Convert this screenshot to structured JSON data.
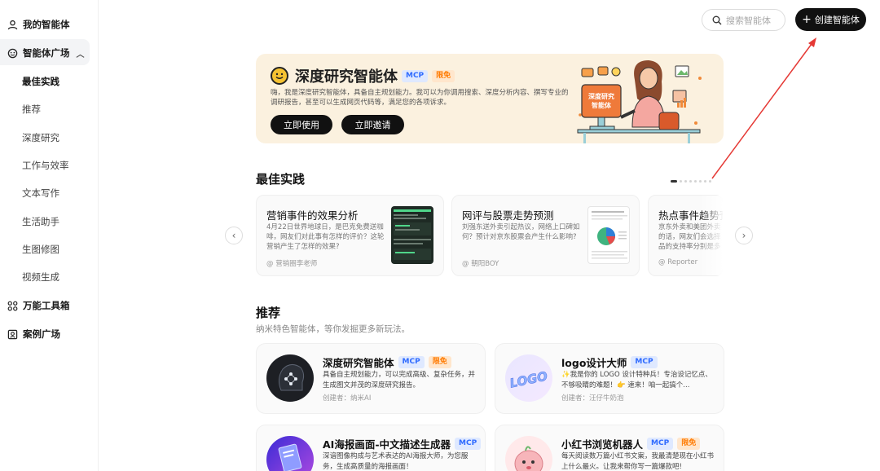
{
  "sidebar": {
    "my_agents": "我的智能体",
    "plaza": "智能体广场",
    "sub_items": [
      "最佳实践",
      "推荐",
      "深度研究",
      "工作与效率",
      "文本写作",
      "生活助手",
      "生图修图",
      "视频生成"
    ],
    "toolbox": "万能工具箱",
    "case_plaza": "案例广场"
  },
  "header": {
    "search_placeholder": "搜索智能体",
    "create_button": "创建智能体"
  },
  "banner": {
    "title": "深度研究智能体",
    "tag_mcp": "MCP",
    "tag_free": "限免",
    "description": "嗨，我是深度研究智能体，具备自主规划能力。我可以为你调用搜索、深度分析内容、撰写专业的调研报告，甚至可以生成网页代码等，满足您的各项诉求。",
    "use_button": "立即使用",
    "invite_button": "立即邀请",
    "illustration_label": "深度研究智能体"
  },
  "best_practice": {
    "title": "最佳实践",
    "cards": [
      {
        "title": "营销事件的效果分析",
        "desc": "4月22日世界地球日，是巴克免费送咖啡，网友们对此事有怎样的评价？这轮营销产生了怎样的效果?",
        "author": "@ 营销圈李老师"
      },
      {
        "title": "网评与股票走势预测",
        "desc": "刘强东送外卖引起热议，网络上口碑如何？预计对京东股票会产生什么影响?",
        "author": "@ 朝阳BOY"
      },
      {
        "title": "热点事件趋势预",
        "desc": "京东外卖和美团外卖的话，网友们会选择品的支持率分别是多",
        "author": "@ Reporter"
      }
    ]
  },
  "recommend": {
    "title": "推荐",
    "subtitle": "纳米特色智能体，等你发掘更多新玩法。",
    "cards": [
      {
        "title": "深度研究智能体",
        "mcp": "MCP",
        "free": "限免",
        "desc": "具备自主规划能力，可以完成高级、复杂任务，并生成图文并茂的深度研究报告。",
        "author": "创建者：纳米AI"
      },
      {
        "title": "logo设计大师",
        "mcp": "MCP",
        "free": "",
        "desc": "✨我是你的 LOGO 设计特种兵！专治设记忆点、不够吸睛的难题！👉 速来！咱一起搞个...",
        "author": "创建者：汪仔牛奶泡",
        "logo_text": "LOGO"
      },
      {
        "title": "AI海报画面-中文描述生成器",
        "mcp": "MCP",
        "free": "",
        "desc": "深谙图像构成与艺术表达的AI海报大师，为您服务，生成高质量的海报画面！",
        "author": ""
      },
      {
        "title": "小红书浏览机器人",
        "mcp": "MCP",
        "free": "限免",
        "desc": "每天阅读数万篇小红书文案，我最清楚现在小红书上什么最火。让我来帮你写一篇爆款吧!",
        "author": ""
      }
    ]
  },
  "colors": {
    "banner_bg": "#fbf1df",
    "mcp": "#2f6bff",
    "free": "#ff7a00",
    "annotation_arrow": "#e53935"
  }
}
